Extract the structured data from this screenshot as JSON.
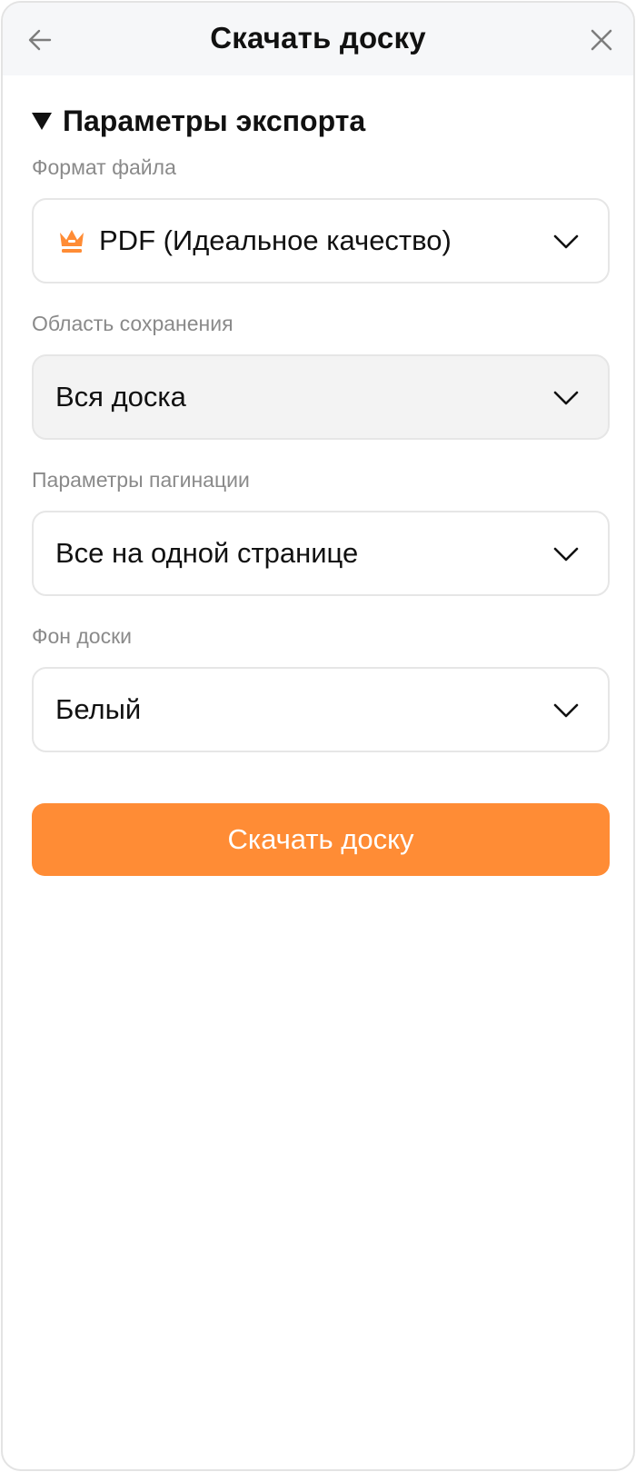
{
  "header": {
    "title": "Скачать доску",
    "back_icon": "arrow-left-icon",
    "close_icon": "close-icon"
  },
  "section": {
    "title": "Параметры экспорта",
    "expanded": true
  },
  "fields": {
    "format": {
      "label": "Формат файла",
      "value": "PDF (Идеальное качество)",
      "icon": "crown-icon"
    },
    "area": {
      "label": "Область сохранения",
      "value": "Вся доска"
    },
    "pagination": {
      "label": "Параметры пагинации",
      "value": "Все на одной странице"
    },
    "background": {
      "label": "Фон доски",
      "value": "Белый"
    }
  },
  "actions": {
    "download_label": "Скачать доску"
  },
  "colors": {
    "accent": "#ff8c35",
    "header_bg": "#f6f7f9",
    "label": "#8a8a8a",
    "text": "#111111"
  }
}
